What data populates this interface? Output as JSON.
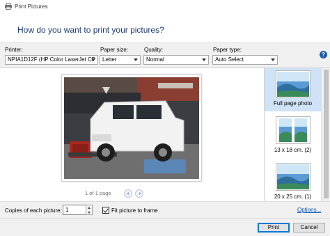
{
  "window": {
    "title": "Print Pictures",
    "icon": "printer-icon"
  },
  "banner": {
    "heading": "How do you want to print your pictures?"
  },
  "options": {
    "printer": {
      "label": "Printer:",
      "value": "NPIA1D12F (HP Color LaserJet CP"
    },
    "paper_size": {
      "label": "Paper size:",
      "value": "Letter"
    },
    "quality": {
      "label": "Quality:",
      "value": "Normal"
    },
    "paper_type": {
      "label": "Paper type:",
      "value": "Auto Select"
    },
    "help": "?"
  },
  "preview": {
    "page_count": "1 of 1 page",
    "image": "white-suv-with-trailer-photo"
  },
  "layouts": [
    {
      "label": "Full page photo",
      "selected": true
    },
    {
      "label": "13 x 18 cm. (2)",
      "selected": false
    },
    {
      "label": "20 x 25 cm. (1)",
      "selected": false
    }
  ],
  "bottom": {
    "copies_label": "Copies of each picture:",
    "copies_value": "1",
    "fit_label": "Fit picture to frame",
    "fit_checked": true,
    "options_link": "Options..."
  },
  "footer": {
    "print_label": "Print",
    "cancel_label": "Cancel"
  },
  "colors": {
    "accent": "#0078d7",
    "heading": "#1e3c78",
    "selected_bg": "#cfe2f6",
    "link": "#0050b4"
  }
}
